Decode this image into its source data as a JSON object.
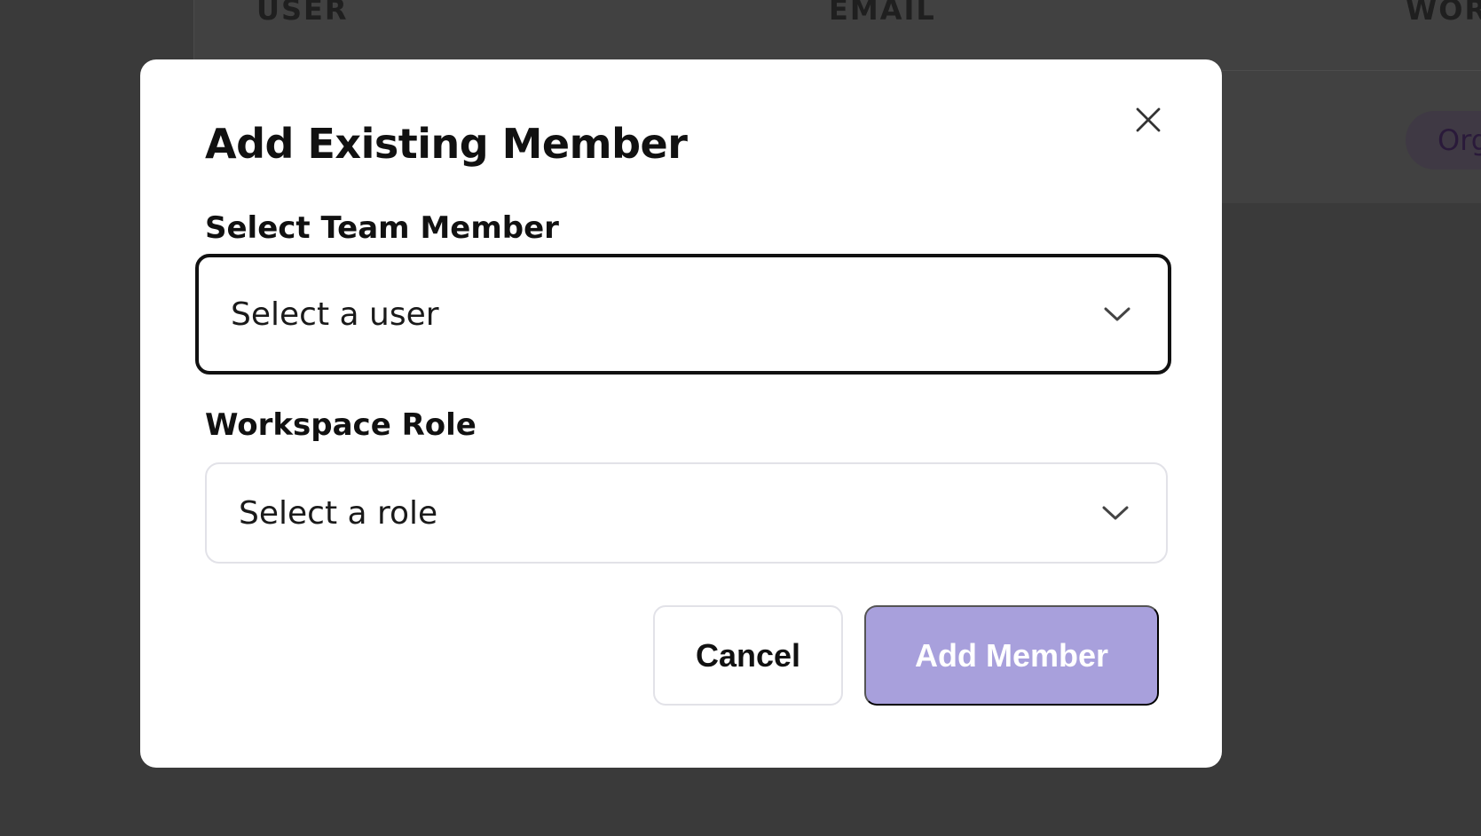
{
  "background": {
    "table": {
      "columns": [
        "USER",
        "EMAIL",
        "WOR"
      ],
      "badge": "Org"
    }
  },
  "modal": {
    "title": "Add Existing Member",
    "close_icon": "close-icon",
    "member_field": {
      "label": "Select Team Member",
      "placeholder": "Select a user"
    },
    "role_field": {
      "label": "Workspace Role",
      "placeholder": "Select a role"
    },
    "buttons": {
      "cancel": "Cancel",
      "add": "Add Member"
    }
  },
  "colors": {
    "overlay": "#3a3a3a",
    "accent_disabled": "#a8a0dc",
    "focus_border": "#111111",
    "border": "#e2e2e8"
  }
}
